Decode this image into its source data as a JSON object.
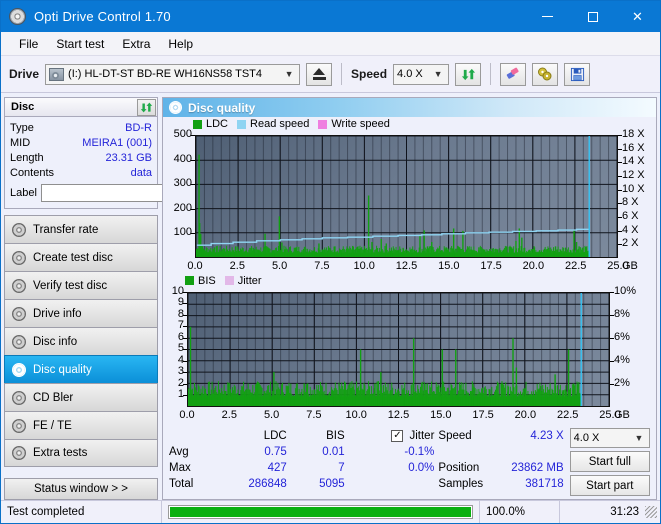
{
  "window": {
    "title": "Opti Drive Control 1.70",
    "icon": "disc-icon",
    "minimize": "–",
    "maximize": "□",
    "close": "✕"
  },
  "menu": [
    "File",
    "Start test",
    "Extra",
    "Help"
  ],
  "toolbar": {
    "drive_label": "Drive",
    "drive_value": "(I:)  HL-DT-ST BD-RE  WH16NS58 TST4",
    "eject_icon": "eject-icon",
    "speed_label": "Speed",
    "speed_value": "4.0 X",
    "refresh_icon": "refresh-icon",
    "erase_icon": "eraser-icon",
    "tools_icon": "disc-tools-icon",
    "save_icon": "save-icon"
  },
  "sidebar": {
    "disc_panel": {
      "title": "Disc",
      "refresh_icon": "refresh-icon",
      "rows": [
        {
          "key": "Type",
          "value": "BD-R"
        },
        {
          "key": "MID",
          "value": "MEIRA1 (001)"
        },
        {
          "key": "Length",
          "value": "23.31 GB"
        },
        {
          "key": "Contents",
          "value": "data"
        }
      ],
      "label_key": "Label",
      "label_value": "",
      "label_placeholder": "",
      "label_button_icon": "cd-icon"
    },
    "items": [
      {
        "label": "Transfer rate",
        "selected": false
      },
      {
        "label": "Create test disc",
        "selected": false
      },
      {
        "label": "Verify test disc",
        "selected": false
      },
      {
        "label": "Drive info",
        "selected": false
      },
      {
        "label": "Disc info",
        "selected": false
      },
      {
        "label": "Disc quality",
        "selected": true
      },
      {
        "label": "CD Bler",
        "selected": false
      },
      {
        "label": "FE / TE",
        "selected": false
      },
      {
        "label": "Extra tests",
        "selected": false
      }
    ],
    "status_button": "Status window > >"
  },
  "main": {
    "header": "Disc quality",
    "header_icon": "disc-quality-icon"
  },
  "chart_data": [
    {
      "type": "line",
      "name": "ldc-chart",
      "title": "",
      "xlabel": "GB",
      "ylabel": "",
      "legend": [
        {
          "label": "LDC",
          "color": "#12a012"
        },
        {
          "label": "Read speed",
          "color": "#8fd4f2"
        },
        {
          "label": "Write speed",
          "color": "#ef7fe0"
        }
      ],
      "legend_position": "top-left",
      "grid": true,
      "xlim": [
        0,
        25
      ],
      "xticks": [
        0.0,
        2.5,
        5.0,
        7.5,
        10.0,
        12.5,
        15.0,
        17.5,
        20.0,
        22.5,
        25.0
      ],
      "xticklabels": [
        "0.0",
        "2.5",
        "5.0",
        "7.5",
        "10.0",
        "12.5",
        "15.0",
        "17.5",
        "20.0",
        "22.5",
        "25.0"
      ],
      "x_unit_label": "GB",
      "ylim": [
        0,
        500
      ],
      "yticks": [
        100,
        200,
        300,
        400,
        500
      ],
      "yticklabels": [
        "100",
        "200",
        "300",
        "400",
        "500"
      ],
      "y2lim": [
        0,
        18
      ],
      "y2ticks": [
        2,
        4,
        6,
        8,
        10,
        12,
        14,
        16,
        18
      ],
      "y2ticklabels": [
        "2 X",
        "4 X",
        "6 X",
        "8 X",
        "10 X",
        "12 X",
        "14 X",
        "16 X",
        "18 X"
      ],
      "series": [
        {
          "name": "LDC",
          "color": "#12a012",
          "kind": "impulse",
          "baseline": 18,
          "points": [
            [
              0.1,
              35
            ],
            [
              0.18,
              423
            ],
            [
              0.22,
              140
            ],
            [
              0.28,
              95
            ],
            [
              0.35,
              46
            ],
            [
              0.5,
              30
            ],
            [
              0.8,
              28
            ],
            [
              1.1,
              40
            ],
            [
              1.4,
              30
            ],
            [
              1.7,
              34
            ],
            [
              2.0,
              28
            ],
            [
              2.35,
              42
            ],
            [
              2.7,
              30
            ],
            [
              3.0,
              26
            ],
            [
              3.4,
              38
            ],
            [
              3.75,
              30
            ],
            [
              4.1,
              96
            ],
            [
              4.3,
              34
            ],
            [
              4.6,
              28
            ],
            [
              4.95,
              168
            ],
            [
              5.1,
              60
            ],
            [
              5.3,
              32
            ],
            [
              5.6,
              26
            ],
            [
              5.95,
              40
            ],
            [
              6.3,
              28
            ],
            [
              6.6,
              34
            ],
            [
              6.95,
              26
            ],
            [
              7.3,
              56
            ],
            [
              7.6,
              30
            ],
            [
              7.9,
              28
            ],
            [
              8.25,
              44
            ],
            [
              8.6,
              26
            ],
            [
              8.95,
              34
            ],
            [
              9.3,
              28
            ],
            [
              9.6,
              42
            ],
            [
              9.95,
              30
            ],
            [
              10.25,
              254
            ],
            [
              10.45,
              62
            ],
            [
              10.7,
              30
            ],
            [
              11.0,
              74
            ],
            [
              11.3,
              56
            ],
            [
              11.6,
              30
            ],
            [
              11.95,
              28
            ],
            [
              12.3,
              38
            ],
            [
              12.6,
              26
            ],
            [
              12.95,
              30
            ],
            [
              13.3,
              88
            ],
            [
              13.55,
              110
            ],
            [
              13.75,
              44
            ],
            [
              14.0,
              62
            ],
            [
              14.3,
              32
            ],
            [
              14.6,
              28
            ],
            [
              14.95,
              30
            ],
            [
              15.3,
              118
            ],
            [
              15.55,
              46
            ],
            [
              15.85,
              108
            ],
            [
              16.1,
              34
            ],
            [
              16.45,
              28
            ],
            [
              16.8,
              40
            ],
            [
              17.1,
              30
            ],
            [
              17.45,
              26
            ],
            [
              17.8,
              34
            ],
            [
              18.1,
              28
            ],
            [
              18.45,
              44
            ],
            [
              18.75,
              30
            ],
            [
              19.0,
              66
            ],
            [
              19.2,
              118
            ],
            [
              19.35,
              80
            ],
            [
              19.5,
              36
            ],
            [
              19.8,
              30
            ],
            [
              20.1,
              40
            ],
            [
              20.4,
              28
            ],
            [
              20.7,
              34
            ],
            [
              21.0,
              26
            ],
            [
              21.35,
              44
            ],
            [
              21.65,
              30
            ],
            [
              21.95,
              36
            ],
            [
              22.25,
              28
            ],
            [
              22.45,
              112
            ],
            [
              22.6,
              62
            ],
            [
              22.75,
              44
            ],
            [
              22.95,
              30
            ],
            [
              23.15,
              34
            ],
            [
              23.3,
              26
            ]
          ]
        },
        {
          "name": "Read speed",
          "color": "#8fd4f2",
          "kind": "step-line",
          "points": [
            [
              0.05,
              1.75
            ],
            [
              0.9,
              2.0
            ],
            [
              2.2,
              2.2
            ],
            [
              3.6,
              2.4
            ],
            [
              5.0,
              2.55
            ],
            [
              6.3,
              2.7
            ],
            [
              7.5,
              2.85
            ],
            [
              9.0,
              2.95
            ],
            [
              10.5,
              3.1
            ],
            [
              12.0,
              3.2
            ],
            [
              13.4,
              3.3
            ],
            [
              14.6,
              3.45
            ],
            [
              16.0,
              3.6
            ],
            [
              17.4,
              3.7
            ],
            [
              18.8,
              3.8
            ],
            [
              20.2,
              3.9
            ],
            [
              21.5,
              4.0
            ],
            [
              22.6,
              4.12
            ],
            [
              23.3,
              4.23
            ]
          ],
          "axis": "right"
        },
        {
          "name": "end-marker",
          "color": "#36c4f5",
          "kind": "vline",
          "x": 23.35
        }
      ]
    },
    {
      "type": "line",
      "name": "bis-chart",
      "title": "",
      "xlabel": "GB",
      "ylabel": "",
      "legend": [
        {
          "label": "BIS",
          "color": "#12a012"
        },
        {
          "label": "Jitter",
          "color": "#e2b8e8"
        }
      ],
      "legend_position": "top-left",
      "grid": true,
      "xlim": [
        0,
        25
      ],
      "xticks": [
        0.0,
        2.5,
        5.0,
        7.5,
        10.0,
        12.5,
        15.0,
        17.5,
        20.0,
        22.5,
        25.0
      ],
      "xticklabels": [
        "0.0",
        "2.5",
        "5.0",
        "7.5",
        "10.0",
        "12.5",
        "15.0",
        "17.5",
        "20.0",
        "22.5",
        "25.0"
      ],
      "x_unit_label": "GB",
      "ylim": [
        0,
        10
      ],
      "yticks": [
        1,
        2,
        3,
        4,
        5,
        6,
        7,
        8,
        9,
        10
      ],
      "yticklabels": [
        "1",
        "2",
        "3",
        "4",
        "5",
        "6",
        "7",
        "8",
        "9",
        "10"
      ],
      "y2lim": [
        0,
        10
      ],
      "y2ticks": [
        2,
        4,
        6,
        8,
        10
      ],
      "y2ticklabels": [
        "2%",
        "4%",
        "6%",
        "8%",
        "10%"
      ],
      "series": [
        {
          "name": "BIS",
          "color": "#12a012",
          "kind": "impulse",
          "baseline": 0.85,
          "points": [
            [
              0.15,
              7.0
            ],
            [
              0.45,
              1.0
            ],
            [
              1.0,
              1.4
            ],
            [
              1.25,
              1.3
            ],
            [
              1.6,
              1.0
            ],
            [
              2.0,
              1.0
            ],
            [
              2.4,
              2.0
            ],
            [
              2.8,
              1.0
            ],
            [
              3.2,
              1.0
            ],
            [
              3.6,
              1.0
            ],
            [
              4.1,
              2.0
            ],
            [
              4.5,
              1.0
            ],
            [
              4.9,
              1.2
            ],
            [
              5.1,
              3.0
            ],
            [
              5.4,
              1.0
            ],
            [
              5.9,
              1.0
            ],
            [
              6.4,
              1.0
            ],
            [
              6.9,
              2.0
            ],
            [
              7.1,
              2.0
            ],
            [
              7.6,
              1.0
            ],
            [
              8.1,
              1.0
            ],
            [
              8.6,
              1.0
            ],
            [
              9.1,
              1.0
            ],
            [
              9.6,
              1.0
            ],
            [
              10.25,
              5.0
            ],
            [
              10.6,
              1.0
            ],
            [
              11.1,
              2.0
            ],
            [
              11.3,
              2.2
            ],
            [
              11.45,
              3.0
            ],
            [
              11.9,
              1.0
            ],
            [
              12.4,
              1.0
            ],
            [
              12.9,
              1.0
            ],
            [
              13.4,
              6.0
            ],
            [
              13.7,
              1.3
            ],
            [
              13.9,
              1.1
            ],
            [
              14.2,
              2.0
            ],
            [
              14.6,
              1.0
            ],
            [
              15.1,
              5.0
            ],
            [
              15.6,
              1.0
            ],
            [
              15.9,
              5.0
            ],
            [
              16.4,
              1.0
            ],
            [
              16.9,
              1.6
            ],
            [
              17.4,
              1.0
            ],
            [
              17.9,
              1.0
            ],
            [
              18.4,
              1.1
            ],
            [
              19.0,
              1.8
            ],
            [
              19.3,
              6.0
            ],
            [
              19.5,
              3.4
            ],
            [
              19.8,
              1.0
            ],
            [
              20.3,
              1.0
            ],
            [
              20.8,
              1.0
            ],
            [
              21.3,
              1.0
            ],
            [
              21.8,
              2.8
            ],
            [
              22.3,
              1.4
            ],
            [
              22.6,
              5.0
            ],
            [
              22.9,
              2.0
            ],
            [
              23.1,
              1.2
            ],
            [
              23.3,
              1.0
            ]
          ]
        },
        {
          "name": "end-marker",
          "color": "#36c4f5",
          "kind": "vline",
          "x": 23.35
        }
      ]
    }
  ],
  "stats": {
    "col_ldc": "LDC",
    "col_bis": "BIS",
    "rows": [
      {
        "label": "Avg",
        "ldc": "0.75",
        "bis": "0.01",
        "jitter": "-0.1%"
      },
      {
        "label": "Max",
        "ldc": "427",
        "bis": "7",
        "jitter": "0.0%"
      },
      {
        "label": "Total",
        "ldc": "286848",
        "bis": "5095",
        "jitter": ""
      }
    ],
    "jitter_label": "Jitter",
    "jitter_checked": true,
    "jitter_check_glyph": "✓",
    "speed_label": "Speed",
    "speed_value": "4.23 X",
    "position_label": "Position",
    "position_value": "23862 MB",
    "samples_label": "Samples",
    "samples_value": "381718",
    "speed_select": "4.0 X",
    "start_full": "Start full",
    "start_part": "Start part"
  },
  "statusbar": {
    "message": "Test completed",
    "progress_percent": 100.0,
    "progress_text": "100.0%",
    "elapsed": "31:23"
  }
}
